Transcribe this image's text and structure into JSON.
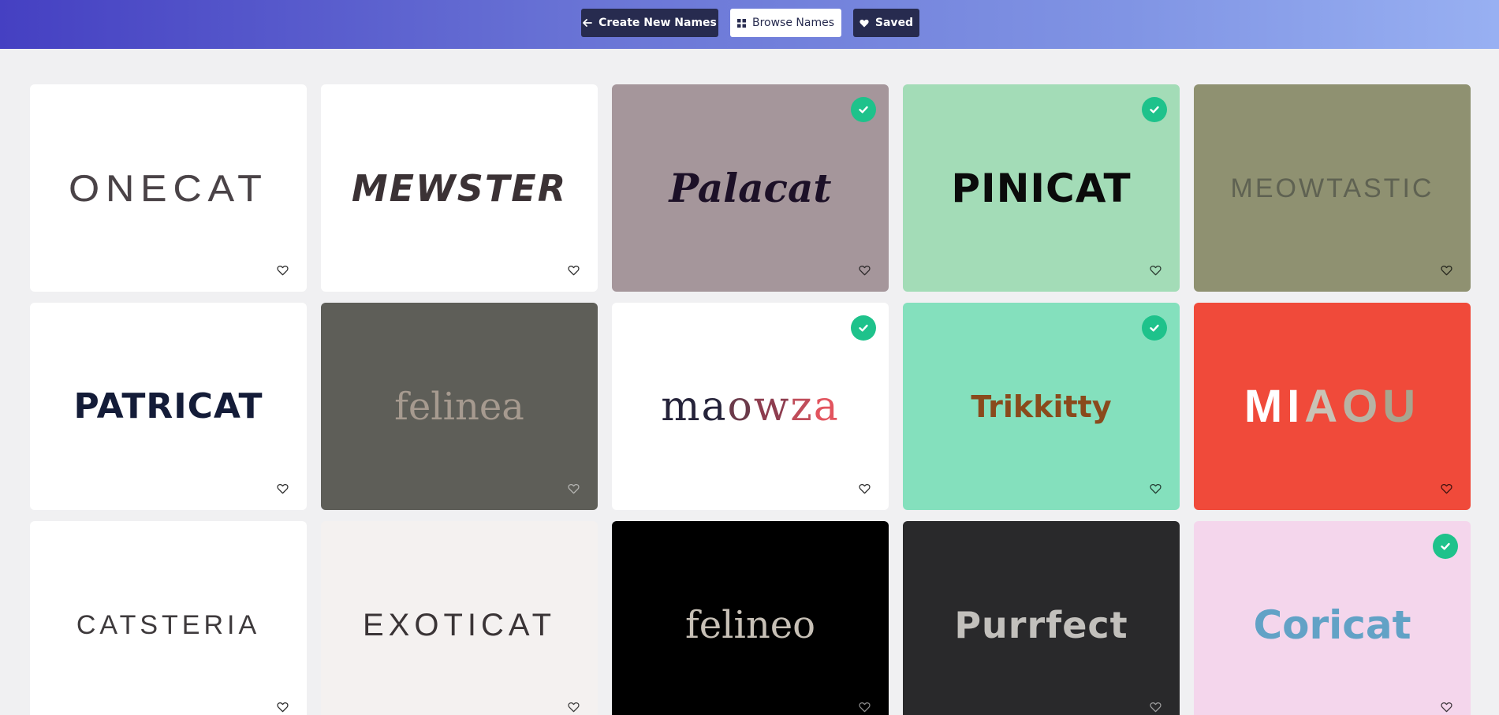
{
  "nav": {
    "create_label": "Create New Names",
    "browse_label": "Browse Names",
    "saved_label": "Saved",
    "create_icon": "arrow-left-icon",
    "browse_icon": "grid-icon",
    "saved_icon": "heart-filled-icon"
  },
  "colors": {
    "header_gradient_start": "#4540c2",
    "header_gradient_end": "#98b0f2",
    "nav_dark": "#272b4f",
    "check_green": "#1ec28b",
    "page_bg": "#f0f0f2"
  },
  "cards": [
    {
      "name": "ONECAT",
      "background": "#ffffff",
      "text_color": "#4a4347",
      "saved": false
    },
    {
      "name": "MEWSTER",
      "background": "#ffffff",
      "text_color": "#3b3235",
      "saved": false
    },
    {
      "name": "Palacat",
      "background": "#a5969b",
      "text_color": "#1c1027",
      "saved": true
    },
    {
      "name": "PINICAT",
      "background": "#a3dcb7",
      "text_color": "#0b0b0b",
      "saved": true
    },
    {
      "name": "MEOWTASTIC",
      "background": "#8f9171",
      "text_color": "#5f6252",
      "saved": false
    },
    {
      "name": "PATRICAT",
      "background": "#ffffff",
      "text_color": "#141c38",
      "saved": false
    },
    {
      "name": "felinea",
      "background": "#5e5e58",
      "text_color": "#a69a8f",
      "saved": false
    },
    {
      "name": "maowza",
      "background": "#ffffff",
      "text_color": "#25233a",
      "saved": true
    },
    {
      "name": "Trikkitty",
      "background": "#84e0bd",
      "text_color": "#8a4a1c",
      "saved": true
    },
    {
      "name": "MIAOU",
      "background": "#f04a3a",
      "text_color": "#ffffff",
      "saved": false
    },
    {
      "name": "CATSTERIA",
      "background": "#ffffff",
      "text_color": "#3e3a3c",
      "saved": false
    },
    {
      "name": "EXOTICAT",
      "background": "#f4f1f0",
      "text_color": "#3a3436",
      "saved": false
    },
    {
      "name": "felineo",
      "background": "#000000",
      "text_color": "#c7c0b6",
      "saved": false
    },
    {
      "name": "Purrfect",
      "background": "#29292b",
      "text_color": "#c2c0bc",
      "saved": false
    },
    {
      "name": "Coricat",
      "background": "#f4d6ec",
      "text_color": "#62a2c6",
      "saved": true
    }
  ]
}
